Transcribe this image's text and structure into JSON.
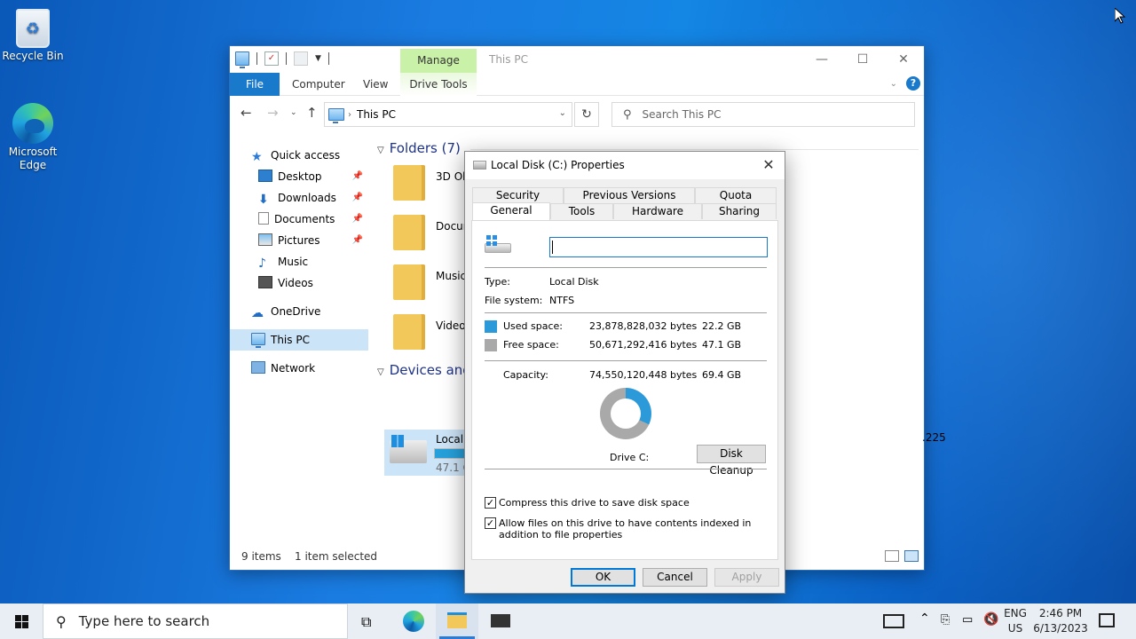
{
  "desktop": {
    "icons": [
      {
        "label": "Recycle Bin"
      },
      {
        "label": "Microsoft Edge"
      }
    ]
  },
  "explorer": {
    "title": "This PC",
    "ribbon": {
      "context_group": "Manage",
      "tabs": [
        "File",
        "Computer",
        "View",
        "Drive Tools"
      ]
    },
    "address": "This PC",
    "search_placeholder": "Search This PC",
    "nav": {
      "quick_access": "Quick access",
      "items": [
        "Desktop",
        "Downloads",
        "Documents",
        "Pictures",
        "Music",
        "Videos"
      ],
      "onedrive": "OneDrive",
      "this_pc": "This PC",
      "network": "Network"
    },
    "groups": {
      "folders": "Folders (7)",
      "devices": "Devices and"
    },
    "folders": [
      "3D Obj",
      "Docum",
      "Music",
      "Videos"
    ],
    "drive": {
      "name": "Local D",
      "free": "47.1 G",
      "used_fraction": 0.32
    },
    "dvd_fragment": ".225",
    "status": {
      "count": "9 items",
      "selected": "1 item selected"
    }
  },
  "dialog": {
    "title": "Local Disk (C:) Properties",
    "tabs_top": [
      "Security",
      "Previous Versions",
      "Quota"
    ],
    "tabs_bottom": [
      "General",
      "Tools",
      "Hardware",
      "Sharing"
    ],
    "name_value": "",
    "type_label": "Type:",
    "type_value": "Local Disk",
    "fs_label": "File system:",
    "fs_value": "NTFS",
    "used_label": "Used space:",
    "used_bytes": "23,878,828,032 bytes",
    "used_gb": "22.2 GB",
    "free_label": "Free space:",
    "free_bytes": "50,671,292,416 bytes",
    "free_gb": "47.1 GB",
    "capacity_label": "Capacity:",
    "capacity_bytes": "74,550,120,448 bytes",
    "capacity_gb": "69.4 GB",
    "drive_label": "Drive C:",
    "cleanup": "Disk Cleanup",
    "compress": "Compress this drive to save disk space",
    "index": "Allow files on this drive to have contents indexed in addition to file properties",
    "ok": "OK",
    "cancel": "Cancel",
    "apply": "Apply",
    "colors": {
      "used": "#2c9ad9",
      "free": "#a9a9a9"
    }
  },
  "taskbar": {
    "search_placeholder": "Type here to search",
    "lang_top": "ENG",
    "lang_bottom": "US",
    "time": "2:46 PM",
    "date": "6/13/2023"
  }
}
